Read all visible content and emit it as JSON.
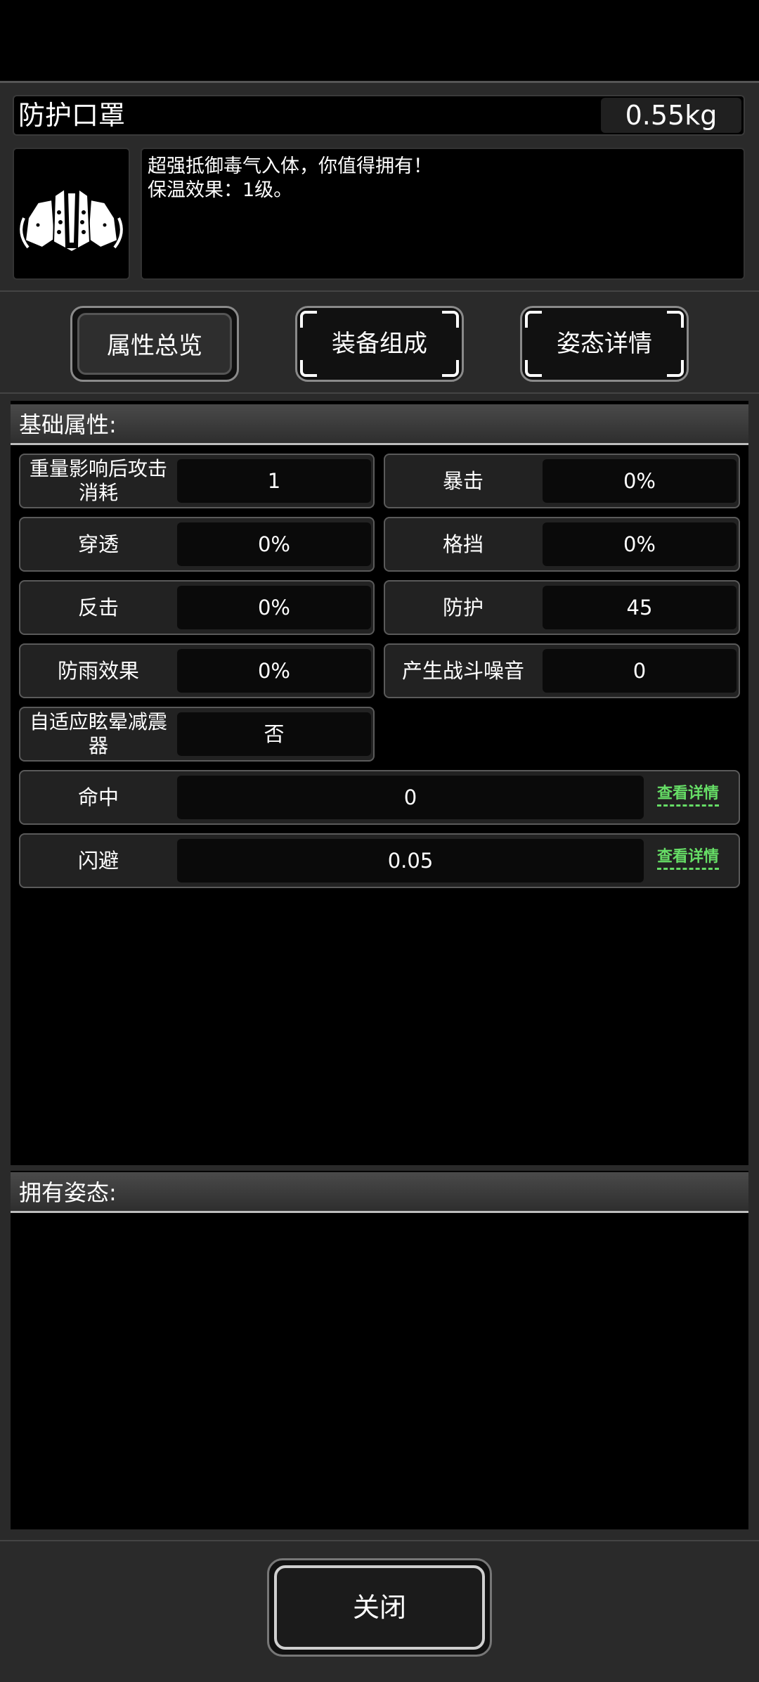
{
  "item": {
    "name": "防护口罩",
    "weight": "0.55kg",
    "icon": "mask-icon",
    "description": [
      "超强抵御毒气入体，你值得拥有！",
      "保温效果：1级。"
    ]
  },
  "tabs": [
    {
      "label": "属性总览",
      "active": true
    },
    {
      "label": "装备组成",
      "active": false
    },
    {
      "label": "姿态详情",
      "active": false
    }
  ],
  "base_attributes": {
    "header": "基础属性:",
    "grid": [
      {
        "label": "重量影响后攻击消耗",
        "value": "1"
      },
      {
        "label": "暴击",
        "value": "0%"
      },
      {
        "label": "穿透",
        "value": "0%"
      },
      {
        "label": "格挡",
        "value": "0%"
      },
      {
        "label": "反击",
        "value": "0%"
      },
      {
        "label": "防护",
        "value": "45"
      },
      {
        "label": "防雨效果",
        "value": "0%"
      },
      {
        "label": "产生战斗噪音",
        "value": "0"
      },
      {
        "label": "自适应眩晕减震器",
        "value": "否"
      }
    ],
    "wide": [
      {
        "label": "命中",
        "value": "0",
        "link": "查看详情"
      },
      {
        "label": "闪避",
        "value": "0.05",
        "link": "查看详情"
      }
    ]
  },
  "stances": {
    "header": "拥有姿态:"
  },
  "close_button": {
    "label": "关闭"
  },
  "colors": {
    "link": "#66dd66",
    "panel": "#2a2a2a",
    "background": "#000000"
  }
}
